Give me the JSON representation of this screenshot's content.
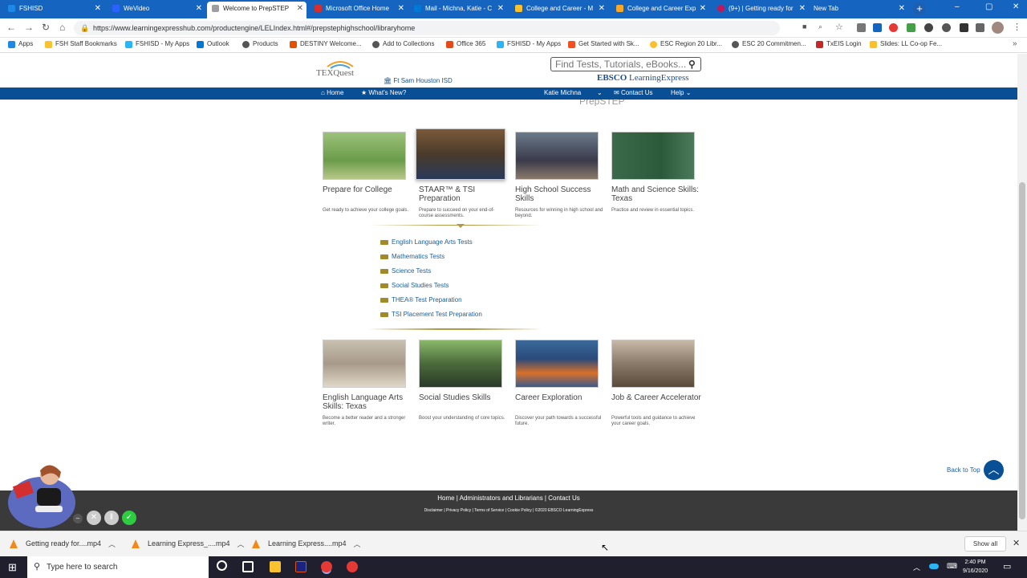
{
  "browser": {
    "tabs": [
      {
        "title": "FSHISD",
        "color": "#1e88e5"
      },
      {
        "title": "WeVideo",
        "color": "#2962ff"
      },
      {
        "title": "Welcome to PrepSTEP",
        "color": "#9e9e9e"
      },
      {
        "title": "Microsoft Office Home",
        "color": "#d32f2f"
      },
      {
        "title": "Mail - Michna, Katie - C",
        "color": "#0078d4"
      },
      {
        "title": "College and Career - M",
        "color": "#fbc02d"
      },
      {
        "title": "College and Career Exp",
        "color": "#f9a825"
      },
      {
        "title": "(9+) | Getting ready for",
        "color": "#c2185b"
      },
      {
        "title": "New Tab",
        "color": "#1565c0"
      }
    ],
    "new_tab": "+",
    "window_controls": [
      "–",
      "▢",
      "✕"
    ],
    "url": "https://www.learningexpresshub.com/productengine/LELIndex.html#/prepstephighschool/libraryhome",
    "bookmarks": [
      "Apps",
      "FSH Staff Bookmarks",
      "FSHISD - My Apps",
      "Outlook",
      "Products",
      "DESTINY Welcome...",
      "Add to Collections",
      "Office 365",
      "FSHISD - My Apps",
      "Get Started with Sk...",
      "ESC Region 20 Libr...",
      "ESC 20 Commitmen...",
      "TxEIS Login",
      "Slides: LL Co-op Fe..."
    ]
  },
  "site": {
    "logo_text": "TEXQuest",
    "district": "Ft Sam Houston ISD",
    "search_placeholder": "Find Tests, Tutorials, eBooks...",
    "ebsco_brand": "EBSCO",
    "ebsco_suffix": "LearningExpress",
    "nav": {
      "home": "Home",
      "whats_new": "What's New?",
      "user": "Katie Michna",
      "contact": "Contact Us",
      "help": "Help"
    },
    "section_heading": "PrepSTEP"
  },
  "cards_top": [
    {
      "title": "Prepare for College",
      "desc": "Get ready to achieve your college goals."
    },
    {
      "title": "STAAR™ & TSI Preparation",
      "desc": "Prepare to succeed on your end-of-course assessments."
    },
    {
      "title": "High School Success Skills",
      "desc": "Resources for winning in high school and beyond."
    },
    {
      "title": "Math and Science Skills: Texas",
      "desc": "Practice and review in essential topics."
    }
  ],
  "sublinks": [
    "English Language Arts Tests",
    "Mathematics Tests",
    "Science Tests",
    "Social Studies Tests",
    "THEA® Test Preparation",
    "TSI Placement Test Preparation"
  ],
  "cards_bottom": [
    {
      "title": "English Language Arts Skills: Texas",
      "desc": "Become a better reader and a stronger writer."
    },
    {
      "title": "Social Studies Skills",
      "desc": "Boost your understanding of core topics."
    },
    {
      "title": "Career Exploration",
      "desc": "Discover your path towards a successful future."
    },
    {
      "title": "Job & Career Accelerator",
      "desc": "Powerful tools and guidance to achieve your career goals."
    }
  ],
  "back_to_top": "Back to Top",
  "footer": {
    "links": "Home | Administrators and Librarians | Contact Us",
    "legal": "Disclaimer | Privacy Policy | Terms of Service | Cookie Policy | ©2020 EBSCO LearningExpress"
  },
  "downloads": {
    "items": [
      "Getting ready for....mp4",
      "Learning Express_....mp4",
      "Learning Express....mp4"
    ],
    "show_all": "Show all"
  },
  "taskbar": {
    "search_placeholder": "Type here to search",
    "time": "2:40 PM",
    "date": "9/16/2020"
  }
}
